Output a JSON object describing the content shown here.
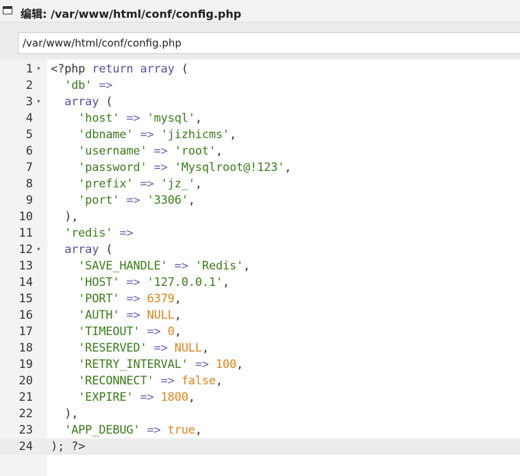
{
  "window": {
    "title": "编辑: /var/www/html/conf/config.php",
    "icon": "window-icon"
  },
  "path_field": {
    "value": "/var/www/html/conf/config.php"
  },
  "editor": {
    "active_line": 24,
    "colors": {
      "keyword": "#5b4fa3",
      "string": "#3c7a1b",
      "operator": "#6a63b0",
      "number": "#e0821c",
      "gutter_bg": "#f3f3f3",
      "active_line_bg": "#ececec"
    },
    "lines": [
      {
        "n": "1",
        "fold": true,
        "tokens": [
          [
            "plain",
            "<?php "
          ],
          [
            "kw",
            "return "
          ],
          [
            "kw",
            "array"
          ],
          [
            "plain",
            " ("
          ]
        ]
      },
      {
        "n": "2",
        "fold": false,
        "tokens": [
          [
            "plain",
            "  "
          ],
          [
            "str",
            "'db'"
          ],
          [
            "plain",
            " "
          ],
          [
            "op",
            "=>"
          ]
        ]
      },
      {
        "n": "3",
        "fold": true,
        "tokens": [
          [
            "plain",
            "  "
          ],
          [
            "kw",
            "array"
          ],
          [
            "plain",
            " ("
          ]
        ]
      },
      {
        "n": "4",
        "fold": false,
        "tokens": [
          [
            "plain",
            "    "
          ],
          [
            "str",
            "'host'"
          ],
          [
            "plain",
            " "
          ],
          [
            "op",
            "=>"
          ],
          [
            "plain",
            " "
          ],
          [
            "str",
            "'mysql'"
          ],
          [
            "plain",
            ","
          ]
        ]
      },
      {
        "n": "5",
        "fold": false,
        "tokens": [
          [
            "plain",
            "    "
          ],
          [
            "str",
            "'dbname'"
          ],
          [
            "plain",
            " "
          ],
          [
            "op",
            "=>"
          ],
          [
            "plain",
            " "
          ],
          [
            "str",
            "'jizhicms'"
          ],
          [
            "plain",
            ","
          ]
        ]
      },
      {
        "n": "6",
        "fold": false,
        "tokens": [
          [
            "plain",
            "    "
          ],
          [
            "str",
            "'username'"
          ],
          [
            "plain",
            " "
          ],
          [
            "op",
            "=>"
          ],
          [
            "plain",
            " "
          ],
          [
            "str",
            "'root'"
          ],
          [
            "plain",
            ","
          ]
        ]
      },
      {
        "n": "7",
        "fold": false,
        "tokens": [
          [
            "plain",
            "    "
          ],
          [
            "str",
            "'password'"
          ],
          [
            "plain",
            " "
          ],
          [
            "op",
            "=>"
          ],
          [
            "plain",
            " "
          ],
          [
            "str",
            "'Mysqlroot@!123'"
          ],
          [
            "plain",
            ","
          ]
        ]
      },
      {
        "n": "8",
        "fold": false,
        "tokens": [
          [
            "plain",
            "    "
          ],
          [
            "str",
            "'prefix'"
          ],
          [
            "plain",
            " "
          ],
          [
            "op",
            "=>"
          ],
          [
            "plain",
            " "
          ],
          [
            "str",
            "'jz_'"
          ],
          [
            "plain",
            ","
          ]
        ]
      },
      {
        "n": "9",
        "fold": false,
        "tokens": [
          [
            "plain",
            "    "
          ],
          [
            "str",
            "'port'"
          ],
          [
            "plain",
            " "
          ],
          [
            "op",
            "=>"
          ],
          [
            "plain",
            " "
          ],
          [
            "str",
            "'3306'"
          ],
          [
            "plain",
            ","
          ]
        ]
      },
      {
        "n": "10",
        "fold": false,
        "tokens": [
          [
            "plain",
            "  ),"
          ]
        ]
      },
      {
        "n": "11",
        "fold": false,
        "tokens": [
          [
            "plain",
            "  "
          ],
          [
            "str",
            "'redis'"
          ],
          [
            "plain",
            " "
          ],
          [
            "op",
            "=>"
          ]
        ]
      },
      {
        "n": "12",
        "fold": true,
        "tokens": [
          [
            "plain",
            "  "
          ],
          [
            "kw",
            "array"
          ],
          [
            "plain",
            " ("
          ]
        ]
      },
      {
        "n": "13",
        "fold": false,
        "tokens": [
          [
            "plain",
            "    "
          ],
          [
            "str",
            "'SAVE_HANDLE'"
          ],
          [
            "plain",
            " "
          ],
          [
            "op",
            "=>"
          ],
          [
            "plain",
            " "
          ],
          [
            "str",
            "'Redis'"
          ],
          [
            "plain",
            ","
          ]
        ]
      },
      {
        "n": "14",
        "fold": false,
        "tokens": [
          [
            "plain",
            "    "
          ],
          [
            "str",
            "'HOST'"
          ],
          [
            "plain",
            " "
          ],
          [
            "op",
            "=>"
          ],
          [
            "plain",
            " "
          ],
          [
            "str",
            "'127.0.0.1'"
          ],
          [
            "plain",
            ","
          ]
        ]
      },
      {
        "n": "15",
        "fold": false,
        "tokens": [
          [
            "plain",
            "    "
          ],
          [
            "str",
            "'PORT'"
          ],
          [
            "plain",
            " "
          ],
          [
            "op",
            "=>"
          ],
          [
            "plain",
            " "
          ],
          [
            "num",
            "6379"
          ],
          [
            "plain",
            ","
          ]
        ]
      },
      {
        "n": "16",
        "fold": false,
        "tokens": [
          [
            "plain",
            "    "
          ],
          [
            "str",
            "'AUTH'"
          ],
          [
            "plain",
            " "
          ],
          [
            "op",
            "=>"
          ],
          [
            "plain",
            " "
          ],
          [
            "const",
            "NULL"
          ],
          [
            "plain",
            ","
          ]
        ]
      },
      {
        "n": "17",
        "fold": false,
        "tokens": [
          [
            "plain",
            "    "
          ],
          [
            "str",
            "'TIMEOUT'"
          ],
          [
            "plain",
            " "
          ],
          [
            "op",
            "=>"
          ],
          [
            "plain",
            " "
          ],
          [
            "num",
            "0"
          ],
          [
            "plain",
            ","
          ]
        ]
      },
      {
        "n": "18",
        "fold": false,
        "tokens": [
          [
            "plain",
            "    "
          ],
          [
            "str",
            "'RESERVED'"
          ],
          [
            "plain",
            " "
          ],
          [
            "op",
            "=>"
          ],
          [
            "plain",
            " "
          ],
          [
            "const",
            "NULL"
          ],
          [
            "plain",
            ","
          ]
        ]
      },
      {
        "n": "19",
        "fold": false,
        "tokens": [
          [
            "plain",
            "    "
          ],
          [
            "str",
            "'RETRY_INTERVAL'"
          ],
          [
            "plain",
            " "
          ],
          [
            "op",
            "=>"
          ],
          [
            "plain",
            " "
          ],
          [
            "num",
            "100"
          ],
          [
            "plain",
            ","
          ]
        ]
      },
      {
        "n": "20",
        "fold": false,
        "tokens": [
          [
            "plain",
            "    "
          ],
          [
            "str",
            "'RECONNECT'"
          ],
          [
            "plain",
            " "
          ],
          [
            "op",
            "=>"
          ],
          [
            "plain",
            " "
          ],
          [
            "const",
            "false"
          ],
          [
            "plain",
            ","
          ]
        ]
      },
      {
        "n": "21",
        "fold": false,
        "tokens": [
          [
            "plain",
            "    "
          ],
          [
            "str",
            "'EXPIRE'"
          ],
          [
            "plain",
            " "
          ],
          [
            "op",
            "=>"
          ],
          [
            "plain",
            " "
          ],
          [
            "num",
            "1800"
          ],
          [
            "plain",
            ","
          ]
        ]
      },
      {
        "n": "22",
        "fold": false,
        "tokens": [
          [
            "plain",
            "  ),"
          ]
        ]
      },
      {
        "n": "23",
        "fold": false,
        "tokens": [
          [
            "plain",
            "  "
          ],
          [
            "str",
            "'APP_DEBUG'"
          ],
          [
            "plain",
            " "
          ],
          [
            "op",
            "=>"
          ],
          [
            "plain",
            " "
          ],
          [
            "const",
            "true"
          ],
          [
            "plain",
            ","
          ]
        ]
      },
      {
        "n": "24",
        "fold": false,
        "tokens": [
          [
            "plain",
            "); ?>"
          ]
        ]
      }
    ]
  }
}
